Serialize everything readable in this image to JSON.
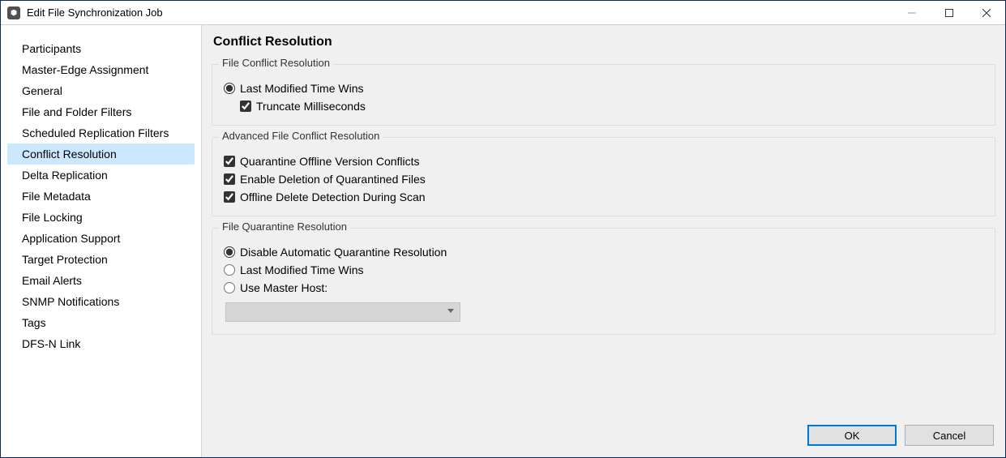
{
  "window": {
    "title": "Edit File Synchronization Job"
  },
  "sidebar": {
    "items": [
      {
        "label": "Participants"
      },
      {
        "label": "Master-Edge Assignment"
      },
      {
        "label": "General"
      },
      {
        "label": "File and Folder Filters"
      },
      {
        "label": "Scheduled Replication Filters"
      },
      {
        "label": "Conflict Resolution"
      },
      {
        "label": "Delta Replication"
      },
      {
        "label": "File Metadata"
      },
      {
        "label": "File Locking"
      },
      {
        "label": "Application Support"
      },
      {
        "label": "Target Protection"
      },
      {
        "label": "Email Alerts"
      },
      {
        "label": "SNMP Notifications"
      },
      {
        "label": "Tags"
      },
      {
        "label": "DFS-N Link"
      }
    ],
    "selectedIndex": 5
  },
  "page": {
    "title": "Conflict Resolution",
    "group1": {
      "legend": "File Conflict Resolution",
      "radio_last_modified": "Last Modified Time Wins",
      "check_truncate": "Truncate Milliseconds"
    },
    "group2": {
      "legend": "Advanced File Conflict Resolution",
      "check_quarantine_offline": "Quarantine Offline Version Conflicts",
      "check_enable_delete_q": "Enable Deletion of Quarantined Files",
      "check_offline_delete_detect": "Offline Delete Detection During Scan"
    },
    "group3": {
      "legend": "File Quarantine Resolution",
      "radio_disable_auto": "Disable Automatic Quarantine Resolution",
      "radio_last_modified": "Last Modified Time Wins",
      "radio_use_master": "Use Master Host:"
    }
  },
  "footer": {
    "ok": "OK",
    "cancel": "Cancel"
  }
}
